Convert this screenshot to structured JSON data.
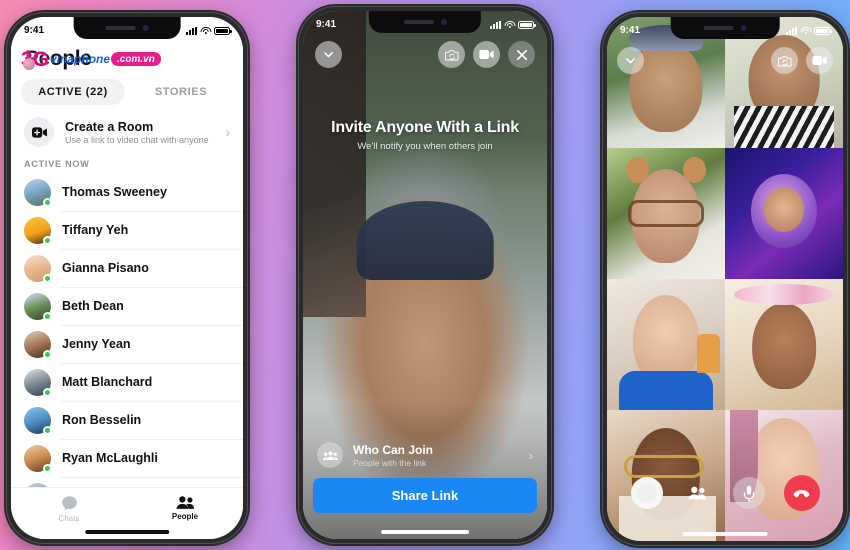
{
  "background": {
    "gradient_from": "#f58cb4",
    "gradient_mid": "#bb92e8",
    "gradient_to": "#63b4fb"
  },
  "colors": {
    "accent_blue": "#1b87f5",
    "online_green": "#2ecc55",
    "end_call_red": "#f23b4e",
    "watermark_pink": "#ea1b8d"
  },
  "phone_left": {
    "status": {
      "time": "9:41",
      "signal_icon": "cellular-bars-icon",
      "wifi_icon": "wifi-icon",
      "battery_icon": "battery-icon"
    },
    "header_title": "People",
    "watermark": {
      "logo": "3G",
      "name": "vinaphone",
      "domain": ".com.vn"
    },
    "tabs": [
      {
        "label": "ACTIVE (22)",
        "active": true
      },
      {
        "label": "STORIES",
        "active": false
      }
    ],
    "create_room": {
      "title": "Create a Room",
      "subtitle": "Use a link to video chat with anyone",
      "icon": "video-plus-icon",
      "chevron": "›"
    },
    "section_header": "ACTIVE NOW",
    "people": [
      {
        "name": "Thomas Sweeney",
        "online": true
      },
      {
        "name": "Tiffany Yeh",
        "online": true
      },
      {
        "name": "Gianna Pisano",
        "online": true
      },
      {
        "name": "Beth Dean",
        "online": true
      },
      {
        "name": "Jenny Yean",
        "online": true
      },
      {
        "name": "Matt Blanchard",
        "online": true
      },
      {
        "name": "Ron Besselin",
        "online": true
      },
      {
        "name": "Ryan McLaughli",
        "online": true
      }
    ],
    "tabbar": [
      {
        "label": "Chats",
        "icon": "chat-bubble-icon",
        "active": false
      },
      {
        "label": "People",
        "icon": "people-icon",
        "active": true
      }
    ]
  },
  "phone_center": {
    "status": {
      "time": "9:41"
    },
    "controls": {
      "minimize_icon": "chevron-down-icon",
      "flip_camera_icon": "camera-flip-icon",
      "video_icon": "video-camera-icon",
      "close_icon": "close-icon"
    },
    "invite": {
      "title": "Invite Anyone With a Link",
      "subtitle": "We'll notify you when others join"
    },
    "who_can_join": {
      "title": "Who Can Join",
      "subtitle": "People with the link",
      "icon": "people-group-icon",
      "chevron": "›"
    },
    "share_button": "Share Link"
  },
  "phone_right": {
    "status": {
      "time": "9:41"
    },
    "top_controls": {
      "minimize_icon": "chevron-down-icon",
      "flip_camera_icon": "camera-flip-icon",
      "video_icon": "video-camera-icon"
    },
    "participants": [
      {
        "id": 1,
        "effect": "none"
      },
      {
        "id": 2,
        "effect": "sparkle"
      },
      {
        "id": 3,
        "effect": "bear-ears"
      },
      {
        "id": 4,
        "effect": "astronaut"
      },
      {
        "id": 5,
        "effect": "none"
      },
      {
        "id": 6,
        "effect": "flower-crown"
      },
      {
        "id": 7,
        "effect": "confetti"
      },
      {
        "id": 8,
        "effect": "none"
      }
    ],
    "call_controls": [
      {
        "name": "effects-button",
        "icon": "effects-circle-icon"
      },
      {
        "name": "add-people-button",
        "icon": "people-icon"
      },
      {
        "name": "microphone-button",
        "icon": "microphone-icon"
      },
      {
        "name": "end-call-button",
        "icon": "phone-hangup-icon"
      }
    ]
  }
}
